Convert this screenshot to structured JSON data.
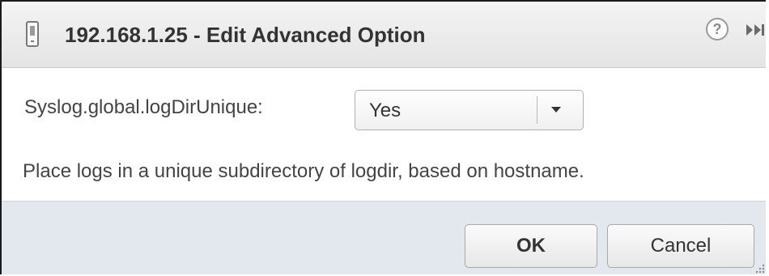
{
  "dialog": {
    "title": "192.168.1.25 - Edit Advanced Option",
    "help_icon_glyph": "?",
    "icons": {
      "title": "host-icon",
      "help": "help-icon",
      "expand": "double-chevron-right-icon"
    }
  },
  "option": {
    "label": "Syslog.global.logDirUnique:",
    "selected_value": "Yes",
    "description": "Place logs in a unique subdirectory of logdir, based on hostname."
  },
  "buttons": {
    "ok_label": "OK",
    "cancel_label": "Cancel"
  },
  "colors": {
    "titlebar": "#e9e9e9",
    "footer": "#e3e7ee",
    "text": "#444444"
  }
}
